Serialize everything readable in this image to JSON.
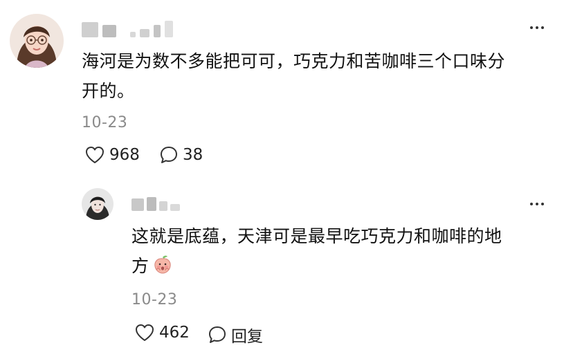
{
  "comment": {
    "text_line1": "海河是为数不多能把可可，巧克力和苦咖啡三个口味分",
    "text_line2": "开的。",
    "date": "10-23",
    "likes": "968",
    "replies": "38",
    "icons": {
      "like": "heart-icon",
      "reply": "speech-bubble-icon",
      "more": "more-icon"
    }
  },
  "reply": {
    "text_line1": "这就是底蕴，天津可是最早吃巧克力和咖啡的地",
    "text_line2": "方",
    "sticker": "peach-sticker",
    "date": "10-23",
    "likes": "462",
    "reply_label": "回复",
    "icons": {
      "like": "heart-icon",
      "reply": "speech-bubble-icon",
      "more": "more-icon"
    }
  },
  "colors": {
    "text": "#111111",
    "meta": "#8a8a8a",
    "blur": "#cfcfcf"
  }
}
